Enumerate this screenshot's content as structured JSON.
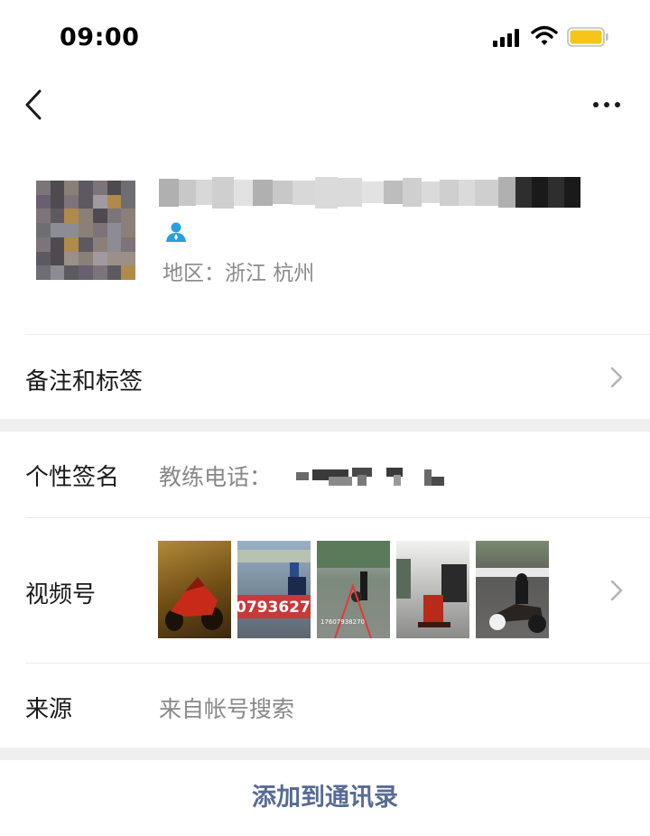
{
  "status_bar": {
    "time": "09:00"
  },
  "profile": {
    "region": "地区：浙江 杭州"
  },
  "rows": {
    "remark_label": "备注和标签",
    "signature_label": "个性签名",
    "signature_value": "教练电话：",
    "channels_label": "视频号",
    "channels_thumbs": [
      {
        "caption": "",
        "tone": "#7a5a1a"
      },
      {
        "caption": "0793627",
        "tone": "#6a7c90"
      },
      {
        "caption": "17607938270",
        "tone": "#7b8a7a"
      },
      {
        "caption": "",
        "tone": "#8a8a8a"
      },
      {
        "caption": "",
        "tone": "#5a5a58"
      }
    ],
    "source_label": "来源",
    "source_value": "来自帐号搜索"
  },
  "actions": {
    "add_contact": "添加到通讯录"
  },
  "colors": {
    "link": "#576b95",
    "secondary_text": "#888888",
    "separator": "#efefef",
    "battery": "#f5c518"
  }
}
